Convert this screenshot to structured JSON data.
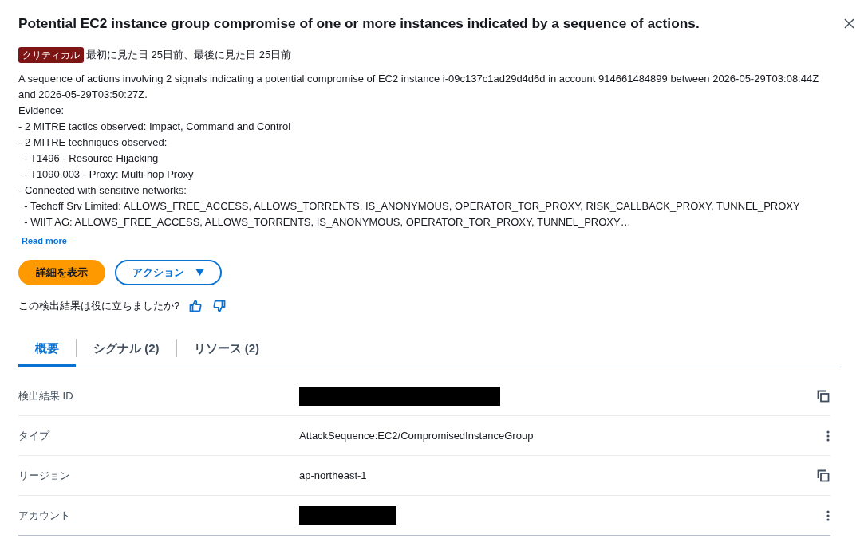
{
  "panel": {
    "title": "Potential EC2 instance group compromise of one or more instances indicated by a sequence of actions."
  },
  "severity": {
    "label": "クリティカル",
    "kind": "critical"
  },
  "seen": "最初に見た日 25日前、最後に見た日 25日前",
  "description": "A sequence of actions involving 2 signals indicating a potential compromise of EC2 instance i-09c137c1ad29d4d6d in account 914661484899 between 2026-05-29T03:08:44Z and 2026-05-29T03:50:27Z.\nEvidence:\n- 2 MITRE tactics observed: Impact, Command and Control\n- 2 MITRE techniques observed:\n  - T1496 - Resource Hijacking\n  - T1090.003 - Proxy: Multi-hop Proxy\n- Connected with sensitive networks:\n  - Techoff Srv Limited: ALLOWS_FREE_ACCESS, ALLOWS_TORRENTS, IS_ANONYMOUS, OPERATOR_TOR_PROXY, RISK_CALLBACK_PROXY, TUNNEL_PROXY\n  - WIIT AG: ALLOWS_FREE_ACCESS, ALLOWS_TORRENTS, IS_ANONYMOUS, OPERATOR_TOR_PROXY, TUNNEL_PROXY…",
  "read_more": "Read more",
  "buttons": [
    {
      "label": "詳細を表示",
      "kind": "primary"
    },
    {
      "label": "アクション",
      "kind": "dropdown"
    }
  ],
  "feedback": {
    "question": "この検出結果は役に立ちましたか?"
  },
  "tabs": [
    {
      "label": "概要",
      "selected": true
    },
    {
      "label": "シグナル (2)",
      "selected": false
    },
    {
      "label": "リソース (2)",
      "selected": false
    }
  ],
  "details": [
    {
      "label": "検出結果 ID",
      "redacted": true,
      "kind": "copy"
    },
    {
      "label": "タイプ",
      "redacted": false,
      "value": "AttackSequence:EC2/CompromisedInstanceGroup",
      "kind": "menu"
    },
    {
      "label": "リージョン",
      "redacted": false,
      "value": "ap-northeast-1",
      "kind": "copy"
    },
    {
      "label": "アカウント",
      "redacted": true,
      "kind": "menu"
    }
  ]
}
